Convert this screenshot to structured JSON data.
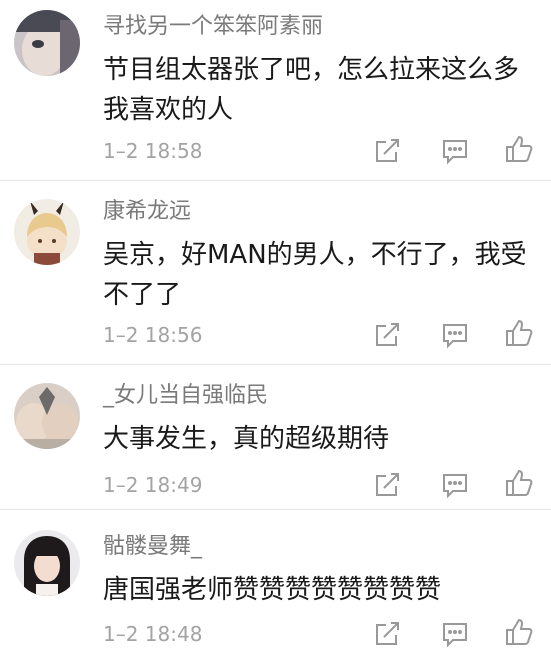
{
  "comments": [
    {
      "name": "寻找另一个笨笨阿素丽",
      "lines": [
        "节目组太器张了吧，怎么拉来这么多",
        "我喜欢的人"
      ],
      "time": "1–2 18:58"
    },
    {
      "name": "康希龙远",
      "lines": [
        "吴京，好MAN的男人，不行了，我受",
        "不了了"
      ],
      "time": "1–2 18:56"
    },
    {
      "name": "_女儿当自强临民",
      "lines": [
        "大事发生，真的超级期待"
      ],
      "time": "1–2 18:49"
    },
    {
      "name": "骷髅曼舞_",
      "lines": [
        "唐国强老师赞赞赞赞赞赞赞赞"
      ],
      "time": "1–2 18:48"
    }
  ],
  "colors": {
    "name": "#7a7a7a",
    "text": "#1a1a1a",
    "meta": "#a3a3a3",
    "icon": "#999999",
    "divider": "#e6e6e6"
  },
  "icons": [
    "share-icon",
    "reply-icon",
    "like-icon"
  ]
}
